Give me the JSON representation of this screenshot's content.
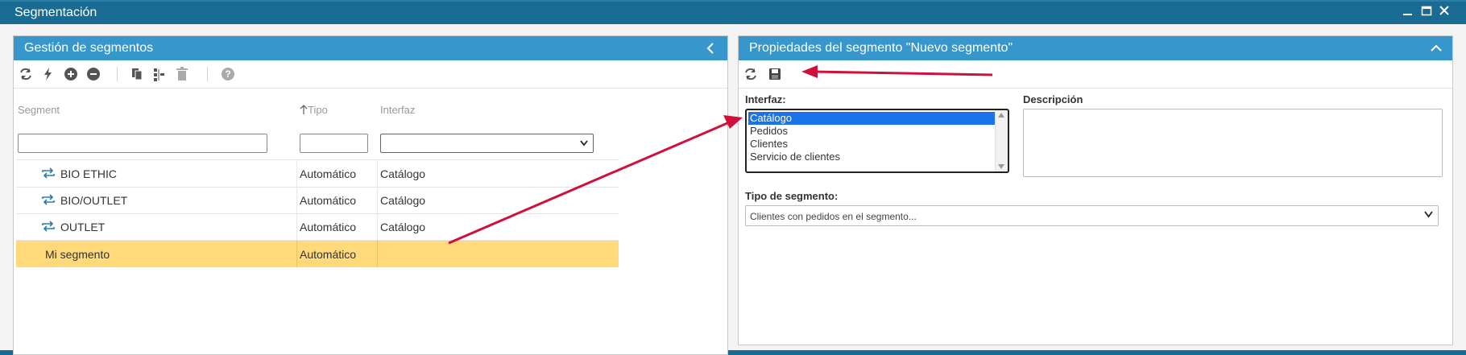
{
  "window": {
    "title": "Segmentación"
  },
  "left_panel": {
    "title": "Gestión de segmentos",
    "columns": {
      "segment": "Segment",
      "tipo": "Tipo",
      "interfaz": "Interfaz"
    },
    "rows": [
      {
        "segment": "BIO ETHIC",
        "tipo": "Automático",
        "interfaz": "Catálogo"
      },
      {
        "segment": "BIO/OUTLET",
        "tipo": "Automático",
        "interfaz": "Catálogo"
      },
      {
        "segment": "OUTLET",
        "tipo": "Automático",
        "interfaz": "Catálogo"
      },
      {
        "segment": "Mi segmento",
        "tipo": "Automático",
        "interfaz": ""
      }
    ],
    "selected_row_color": "#ffd97a",
    "toolbar_icons": [
      "refresh-icon",
      "lightning-icon",
      "add-icon",
      "remove-icon",
      "copy-icon",
      "tree-icon",
      "trash-icon",
      "help-icon"
    ]
  },
  "right_panel": {
    "title": "Propiedades del segmento \"Nuevo segmento\"",
    "toolbar_icons": [
      "refresh-icon",
      "save-icon"
    ],
    "interfaz_label": "Interfaz:",
    "interfaz_options": [
      "Catálogo",
      "Pedidos",
      "Clientes",
      "Servicio de clientes"
    ],
    "interfaz_selected": "Catálogo",
    "descripcion_label": "Descripción",
    "descripcion_value": "",
    "tipo_label": "Tipo de segmento:",
    "tipo_value": "Clientes con pedidos en el segmento..."
  },
  "colors": {
    "header": "#3797cc",
    "titlebar": "#1a6b93",
    "arrow": "#d0103a"
  }
}
